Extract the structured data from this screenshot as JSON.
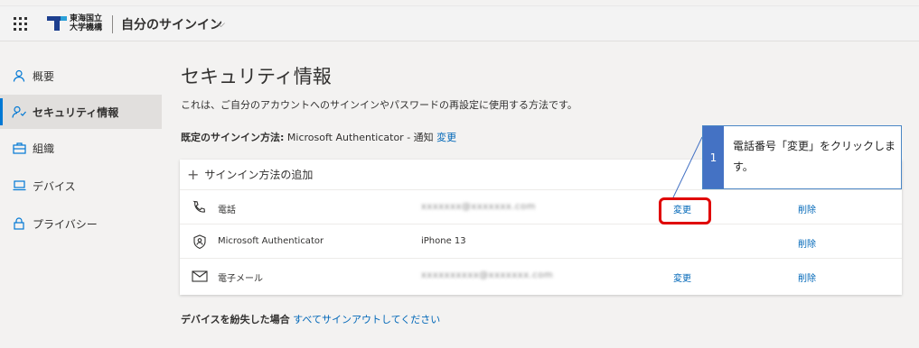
{
  "header": {
    "org_name_line1": "東海国立",
    "org_name_line2": "大学機構",
    "app_title": "自分のサインイン",
    "chevron": "⌵"
  },
  "sidebar": {
    "items": [
      {
        "label": "概要",
        "icon": "person-icon"
      },
      {
        "label": "セキュリティ情報",
        "icon": "security-info-icon",
        "active": true
      },
      {
        "label": "組織",
        "icon": "briefcase-icon"
      },
      {
        "label": "デバイス",
        "icon": "laptop-icon"
      },
      {
        "label": "プライバシー",
        "icon": "lock-icon"
      }
    ]
  },
  "main": {
    "title": "セキュリティ情報",
    "description": "これは、ご自分のアカウントへのサインインやパスワードの再設定に使用する方法です。",
    "default_method_label": "既定のサインイン方法:",
    "default_method_value": "Microsoft Authenticator - 通知",
    "default_method_change": "変更",
    "add_method": "サインイン方法の追加",
    "methods": [
      {
        "type": "電話",
        "icon": "phone-icon",
        "value": "xxxxxxx@xxxxxxx.com",
        "change": "変更",
        "delete": "削除"
      },
      {
        "type": "Microsoft Authenticator",
        "icon": "authenticator-icon",
        "value": "iPhone 13",
        "change": "",
        "delete": "削除"
      },
      {
        "type": "電子メール",
        "icon": "mail-icon",
        "value": "xxxxxxxxxx@xxxxxxx.com",
        "change": "変更",
        "delete": "削除"
      }
    ],
    "lost_device_label": "デバイスを紛失した場合",
    "lost_device_link": "すべてサインアウトしてください"
  },
  "annotation": {
    "step_number": "1",
    "text": "電話番号「変更」をクリックします。",
    "highlight_color": "#e00000",
    "badge_color": "#4472c4"
  },
  "colors": {
    "accent": "#0078d4",
    "link": "#0067b8"
  }
}
